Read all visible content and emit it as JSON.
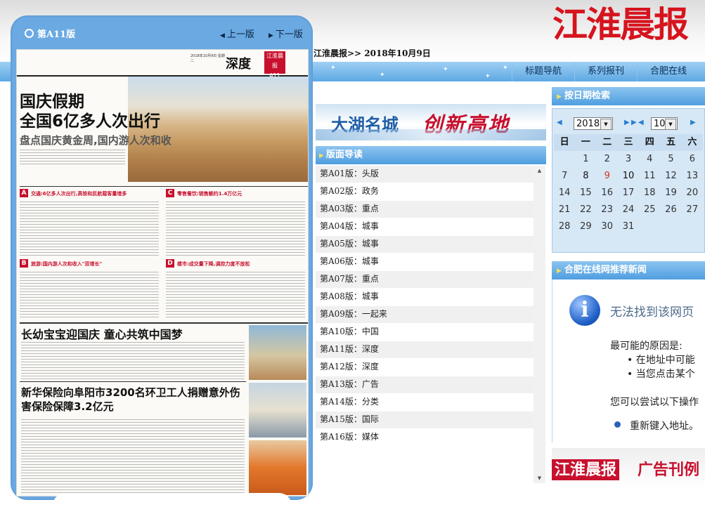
{
  "site": {
    "logo": "江淮晨报",
    "breadcrumb": "江淮晨报>> 2018年10月9日"
  },
  "nav": {
    "items": [
      "标题导航",
      "系列报刊",
      "合肥在线"
    ]
  },
  "reader": {
    "page_label": "第A11版",
    "prev": "上一版",
    "next": "下一版",
    "paper": {
      "date_line": "2018年10月9日 星期二",
      "section": "深度",
      "badge_top": "江淮晨报",
      "badge_page": "A11",
      "headline1_line1": "国庆假期",
      "headline1_line2": "全国6亿多人次出行",
      "subhead1": "盘点国庆黄金周,国内游人次和收",
      "sec_a_tag": "A",
      "sec_a_title": "交通:6亿多人次出行,高铁和民航载客量增多",
      "sec_b_tag": "B",
      "sec_b_title": "旅游:国内游人次和收入\"双增长\"",
      "sec_c_tag": "C",
      "sec_c_title": "零售餐饮:销售额约1.4万亿元",
      "sec_d_tag": "D",
      "sec_d_title": "楼市:成交量下降,调控力度不放松",
      "headline2": "长幼宝宝迎国庆 童心共筑中国梦",
      "headline3": "新华保险向阜阳市3200名环卫工人捐赠意外伤害保险保障3.2亿元"
    }
  },
  "banner": {
    "text1": "大湖名城",
    "text2": "创新高地"
  },
  "guide": {
    "title": "版面导读",
    "items": [
      "第A01版：头版",
      "第A02版：政务",
      "第A03版：重点",
      "第A04版：城事",
      "第A05版：城事",
      "第A06版：城事",
      "第A07版：重点",
      "第A08版：城事",
      "第A09版：一起来",
      "第A10版：中国",
      "第A11版：深度",
      "第A12版：深度",
      "第A13版：广告",
      "第A14版：分类",
      "第A15版：国际",
      "第A16版：媒体"
    ]
  },
  "calendar": {
    "title": "按日期检索",
    "year": "2018",
    "month": "10",
    "weekdays": [
      "日",
      "一",
      "二",
      "三",
      "四",
      "五",
      "六"
    ],
    "weeks": [
      [
        "",
        "1",
        "2",
        "3",
        "4",
        "5",
        "6"
      ],
      [
        "7",
        "8",
        "9",
        "10",
        "11",
        "12",
        "13"
      ],
      [
        "14",
        "15",
        "16",
        "17",
        "18",
        "19",
        "20"
      ],
      [
        "21",
        "22",
        "23",
        "24",
        "25",
        "26",
        "27"
      ],
      [
        "28",
        "29",
        "30",
        "31",
        "",
        "",
        ""
      ],
      [
        "",
        "",
        "",
        "",
        "",
        "",
        ""
      ]
    ],
    "highlight_day": "9",
    "bold_days": [
      "8",
      "10"
    ]
  },
  "news": {
    "title": "合肥在线网推荐新闻",
    "error_title": "无法找到该网页",
    "reason": "最可能的原因是:",
    "bullets": [
      "在地址中可能",
      "当您点击某个"
    ],
    "try": "您可以尝试以下操作",
    "link": "重新键入地址。"
  },
  "ad": {
    "text1": "江淮晨报",
    "text2": "广告刊例"
  },
  "colors": {
    "brand_red": "#d6141e",
    "nav_blue": "#5da8e3",
    "reader_blue": "#6aa9e2"
  }
}
